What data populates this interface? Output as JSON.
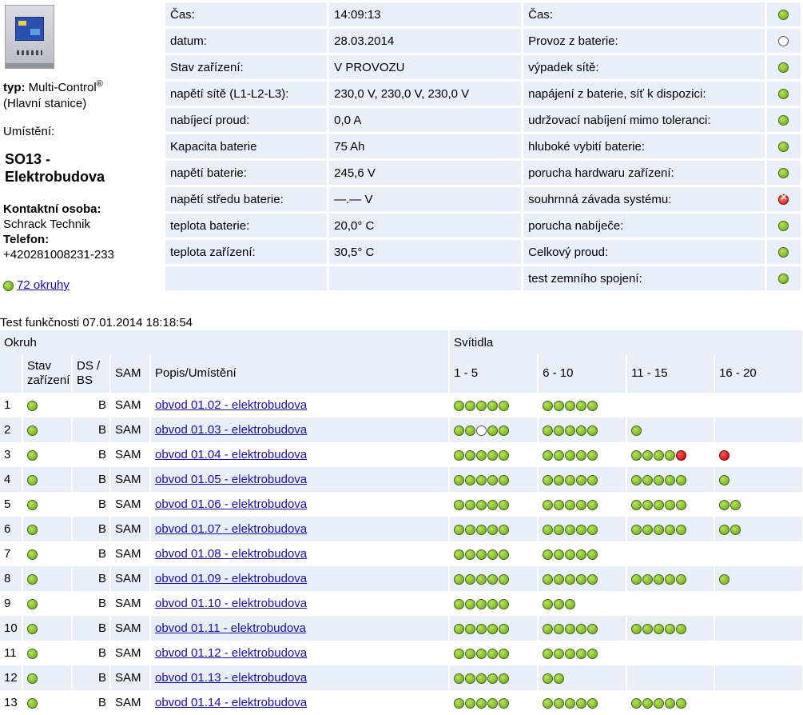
{
  "device": {
    "typ_label": "typ:",
    "typ_value": "Multi-Control",
    "typ_sup": "®",
    "typ_sub": "(Hlavní stanice)",
    "umisteni_label": "Umístění:",
    "umisteni_line1": "SO13 -",
    "umisteni_line2": "Elektrobudova",
    "kontakt_label": "Kontaktní osoba:",
    "kontakt_value": "Schrack Technik",
    "telefon_label": "Telefon:",
    "telefon_value": "+420281008231-233",
    "okruhy_status": "green",
    "okruhy_link": "72 okruhy"
  },
  "status_left": [
    {
      "label": "Čas:",
      "value": "14:09:13"
    },
    {
      "label": "datum:",
      "value": "28.03.2014"
    },
    {
      "label": "Stav zařízení:",
      "value": "V PROVOZU"
    },
    {
      "label": "napětí sítě (L1-L2-L3):",
      "value": "230,0 V, 230,0 V, 230,0 V"
    },
    {
      "label": "nabíjecí proud:",
      "value": "0,0 A"
    },
    {
      "label": "Kapacita baterie",
      "value": "75 Ah"
    },
    {
      "label": "napětí baterie:",
      "value": "245,6 V"
    },
    {
      "label": "napětí středu baterie:",
      "value": "—.— V"
    },
    {
      "label": "teplota baterie:",
      "value": "20,0° C"
    },
    {
      "label": "teplota zařízení:",
      "value": "30,5° C"
    },
    {
      "label": "",
      "value": ""
    }
  ],
  "status_right": [
    {
      "label": "Čas:",
      "state": "green"
    },
    {
      "label": "Provoz z baterie:",
      "state": "white"
    },
    {
      "label": "výpadek sítě:",
      "state": "green"
    },
    {
      "label": "napájení z baterie, síť k dispozici:",
      "state": "green"
    },
    {
      "label": "udržovací nabíjení mimo toleranci:",
      "state": "green"
    },
    {
      "label": "hluboké vybití baterie:",
      "state": "green"
    },
    {
      "label": "porucha hardwaru zařízení:",
      "state": "green"
    },
    {
      "label": "souhrnná závada systému:",
      "state": "error"
    },
    {
      "label": "porucha nabíječe:",
      "state": "green"
    },
    {
      "label": "Celkový proud:",
      "state": "green"
    },
    {
      "label": "test zemního spojení:",
      "state": "green"
    }
  ],
  "test": {
    "caption": "Test funkčnosti 07.01.2014 18:18:54"
  },
  "circuit_table": {
    "okruh_header": "Okruh",
    "svitidla_header": "Svítidla",
    "col_stav_1": "Stav",
    "col_stav_2": "zařízení",
    "col_dsbs_1": "DS /",
    "col_dsbs_2": "BS",
    "col_sam": "SAM",
    "col_popis": "Popis/Umístění",
    "ranges": [
      "1 - 5",
      "6 - 10",
      "11 - 15",
      "16 - 20"
    ],
    "rows": [
      {
        "num": "1",
        "state": "green",
        "dsbs": "B",
        "sam": "SAM",
        "desc": "obvod 01.02 - elektrobudova",
        "lamps": [
          "ggggg",
          "ggggg",
          "",
          ""
        ]
      },
      {
        "num": "2",
        "state": "green",
        "dsbs": "B",
        "sam": "SAM",
        "desc": "obvod 01.03 - elektrobudova",
        "lamps": [
          "ggwgg",
          "ggggg",
          "g",
          ""
        ]
      },
      {
        "num": "3",
        "state": "green",
        "dsbs": "B",
        "sam": "SAM",
        "desc": "obvod 01.04 - elektrobudova",
        "lamps": [
          "ggggg",
          "ggggg",
          "ggggr",
          "r"
        ]
      },
      {
        "num": "4",
        "state": "green",
        "dsbs": "B",
        "sam": "SAM",
        "desc": "obvod 01.05 - elektrobudova",
        "lamps": [
          "ggggg",
          "ggggg",
          "ggggg",
          "g"
        ]
      },
      {
        "num": "5",
        "state": "green",
        "dsbs": "B",
        "sam": "SAM",
        "desc": "obvod 01.06 - elektrobudova",
        "lamps": [
          "ggggg",
          "ggggg",
          "ggggg",
          "gg"
        ]
      },
      {
        "num": "6",
        "state": "green",
        "dsbs": "B",
        "sam": "SAM",
        "desc": "obvod 01.07 - elektrobudova",
        "lamps": [
          "ggggg",
          "ggggg",
          "ggggg",
          "gg"
        ]
      },
      {
        "num": "7",
        "state": "green",
        "dsbs": "B",
        "sam": "SAM",
        "desc": "obvod 01.08 - elektrobudova",
        "lamps": [
          "ggggg",
          "ggggg",
          "",
          ""
        ]
      },
      {
        "num": "8",
        "state": "green",
        "dsbs": "B",
        "sam": "SAM",
        "desc": "obvod 01.09 - elektrobudova",
        "lamps": [
          "ggggg",
          "ggggg",
          "ggggg",
          "g"
        ]
      },
      {
        "num": "9",
        "state": "green",
        "dsbs": "B",
        "sam": "SAM",
        "desc": "obvod 01.10 - elektrobudova",
        "lamps": [
          "ggggg",
          "ggg",
          "",
          ""
        ]
      },
      {
        "num": "10",
        "state": "green",
        "dsbs": "B",
        "sam": "SAM",
        "desc": "obvod 01.11 - elektrobudova",
        "lamps": [
          "ggggg",
          "ggggg",
          "ggggg",
          ""
        ]
      },
      {
        "num": "11",
        "state": "green",
        "dsbs": "B",
        "sam": "SAM",
        "desc": "obvod 01.12 - elektrobudova",
        "lamps": [
          "ggggg",
          "ggggg",
          "",
          ""
        ]
      },
      {
        "num": "12",
        "state": "green",
        "dsbs": "B",
        "sam": "SAM",
        "desc": "obvod 01.13 - elektrobudova",
        "lamps": [
          "ggggg",
          "gg",
          "",
          ""
        ]
      },
      {
        "num": "13",
        "state": "green",
        "dsbs": "B",
        "sam": "SAM",
        "desc": "obvod 01.14 - elektrobudova",
        "lamps": [
          "ggggg",
          "ggggg",
          "ggggg",
          ""
        ]
      }
    ]
  }
}
